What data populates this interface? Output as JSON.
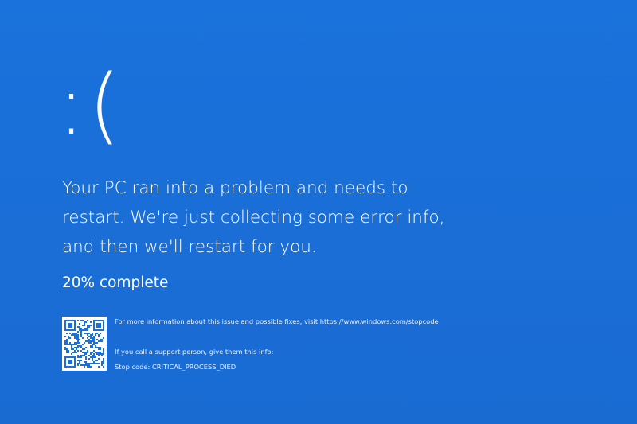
{
  "colors": {
    "background": "#1a6fd8",
    "text": "#ffffff"
  },
  "sad_face": ":(",
  "message": "Your PC ran into a problem and needs to restart. We're just collecting some error info, and then we'll restart for you.",
  "progress": {
    "percent": 20,
    "text": "20% complete"
  },
  "qr_code": {
    "icon": "qr-code-icon"
  },
  "info": {
    "more_info": "For more information about this issue and possible fixes, visit https://www.windows.com/stopcode",
    "support_prompt": "If you call a support person, give them this info:",
    "stop_code": "Stop code: CRITICAL_PROCESS_DIED"
  }
}
